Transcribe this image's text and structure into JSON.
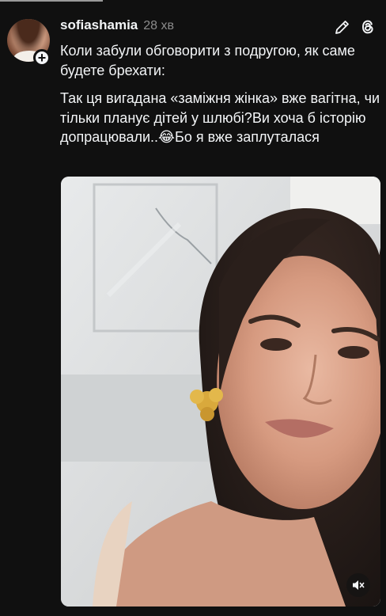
{
  "post": {
    "username": "sofiashamia",
    "time_ago": "28 хв",
    "follow_symbol": "+",
    "paragraphs": [
      "Коли забули обговорити з подругою, як саме будете брехати:",
      "Так ця вигадана «заміжня жінка» вже вагітна, чи тільки планує дітей у шлюбі?Ви хоча б історію допрацювали..😂Бо я вже заплуталася"
    ]
  },
  "icons": {
    "edit": "pencil-icon",
    "app": "threads-logo-icon",
    "mute": "speaker-muted-icon"
  },
  "colors": {
    "background": "#101010",
    "text": "#f3f5f7",
    "secondary_text": "#8b8b8b"
  }
}
